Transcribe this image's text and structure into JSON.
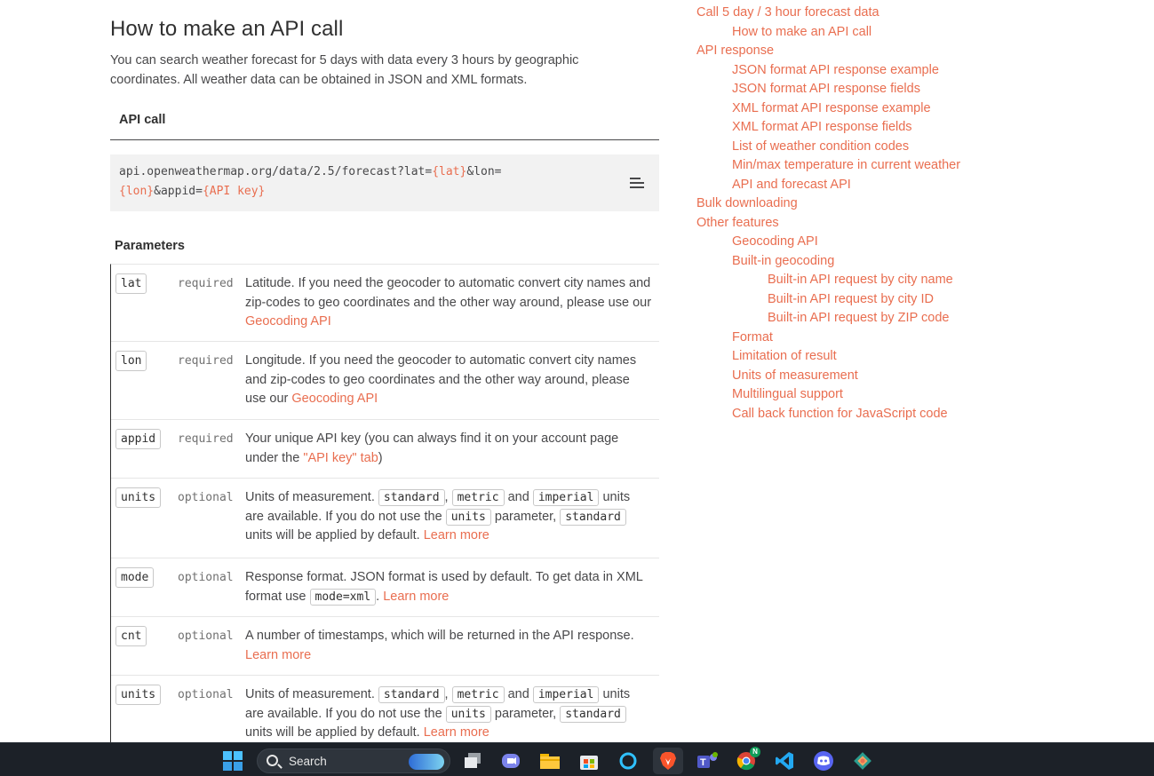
{
  "main": {
    "title": "How to make an API call",
    "intro": "You can search weather forecast for 5 days with data every 3 hours by geographic coordinates. All weather data can be obtained in JSON and XML formats.",
    "api_call_heading": "API call",
    "code": {
      "p1": "api.openweathermap.org/data/2.5/forecast?lat=",
      "v1": "{lat}",
      "p2": "&lon=",
      "v2": "{lon}",
      "p3": "&appid=",
      "v3": "{API key}"
    },
    "params_heading": "Parameters",
    "params": [
      {
        "name": "lat",
        "req": "required",
        "d1": "Latitude. If you need the geocoder to automatic convert city names and zip-codes to geo coordinates and the other way around, please use our ",
        "link": "Geocoding API"
      },
      {
        "name": "lon",
        "req": "required",
        "d1": "Longitude. If you need the geocoder to automatic convert city names and zip-codes to geo coordinates and the other way around, please use our ",
        "link": "Geocoding API"
      },
      {
        "name": "appid",
        "req": "required",
        "d1": "Your unique API key (you can always find it on your account page under the ",
        "link": "\"API key\" tab",
        "d2": ")"
      },
      {
        "name": "units",
        "req": "optional",
        "d1": "Units of measurement. ",
        "c1": "standard",
        "s1": ", ",
        "c2": "metric",
        "s2": " and ",
        "c3": "imperial",
        "s3": " units are available. If you do not use the ",
        "c4": "units",
        "s4": " parameter, ",
        "c5": "standard",
        "s5": " units will be applied by default. ",
        "link": "Learn more"
      },
      {
        "name": "mode",
        "req": "optional",
        "d1": "Response format. JSON format is used by default. To get data in XML format use ",
        "c1": "mode=xml",
        "s1": ". ",
        "link": "Learn more"
      },
      {
        "name": "cnt",
        "req": "optional",
        "d1": "A number of timestamps, which will be returned in the API response. ",
        "link": "Learn more"
      },
      {
        "name": "units",
        "req": "optional",
        "d1": "Units of measurement. ",
        "c1": "standard",
        "s1": ", ",
        "c2": "metric",
        "s2": " and ",
        "c3": "imperial",
        "s3": " units are available. If you do not use the ",
        "c4": "units",
        "s4": " parameter, ",
        "c5": "standard",
        "s5": " units will be applied by default. ",
        "link": "Learn more"
      }
    ]
  },
  "toc": [
    "Call 5 day / 3 hour forecast data",
    "How to make an API call",
    "API response",
    "JSON format API response example",
    "JSON format API response fields",
    "XML format API response example",
    "XML format API response fields",
    "List of weather condition codes",
    "Min/max temperature in current weather",
    "API and forecast API",
    "Bulk downloading",
    "Other features",
    "Geocoding API",
    "Built-in geocoding",
    "Built-in API request by city name",
    "Built-in API request by city ID",
    "Built-in API request by ZIP code",
    "Format",
    "Limitation of result",
    "Units of measurement",
    "Multilingual support",
    "Call back function for JavaScript code"
  ],
  "taskbar": {
    "search_label": "Search",
    "chrome_badge": "N"
  },
  "colors": {
    "accent": "#e96e50",
    "text": "#48484a",
    "code_bg": "#f2f2f2",
    "taskbar_bg": "#1c2128"
  }
}
